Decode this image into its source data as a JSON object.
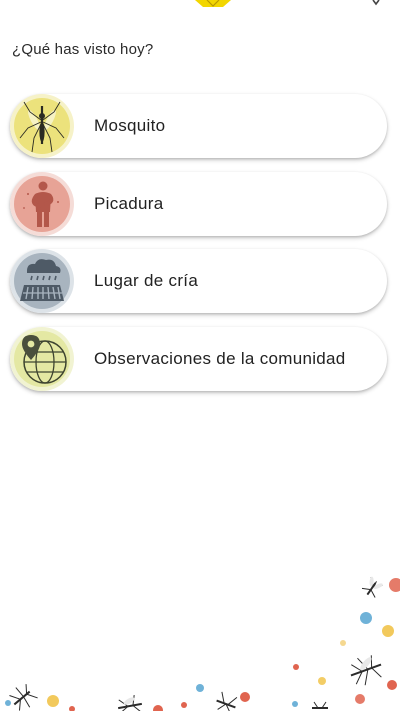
{
  "question": "¿Qué has visto hoy?",
  "options": [
    {
      "label": "Mosquito",
      "icon": "mosquito-icon",
      "color": "#efe38c"
    },
    {
      "label": "Picadura",
      "icon": "bite-icon",
      "color": "#e8a79d"
    },
    {
      "label": "Lugar de cría",
      "icon": "breeding-site-icon",
      "color": "#a9b5c0"
    },
    {
      "label": "Observaciones de la comunidad",
      "icon": "community-globe-icon",
      "color": "#e6eaa8"
    }
  ],
  "colors": {
    "accent_yellow": "#f2d600",
    "dot_red": "#e0644f",
    "dot_blue": "#6fb2d8",
    "dot_yellow": "#f0c040"
  }
}
